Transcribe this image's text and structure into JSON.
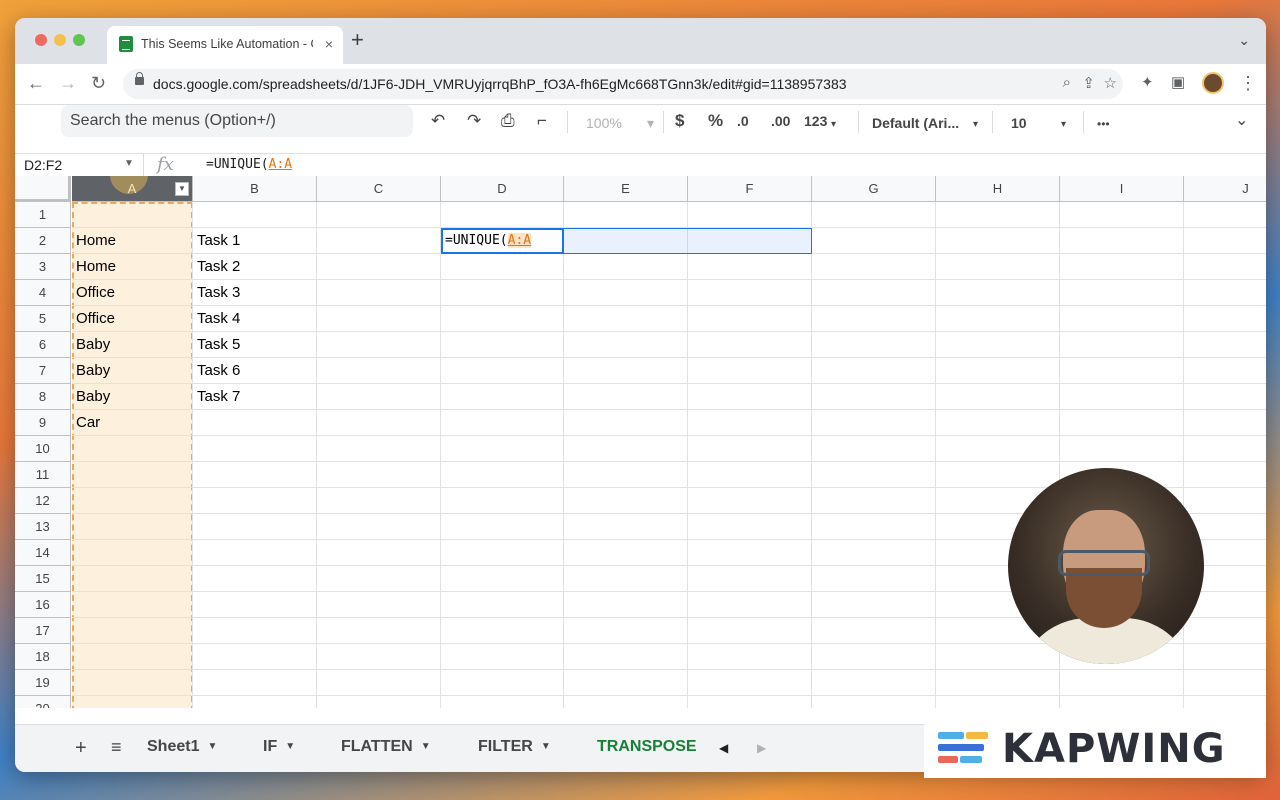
{
  "browser": {
    "tab_title": "This Seems Like Automation - G",
    "tab_close": "×",
    "new_tab": "+",
    "tabs_menu": "⌄",
    "url": "docs.google.com/spreadsheets/d/1JF6-JDH_VMRUyjqrrqBhP_fO3A-fh6EgMc668TGnn3k/edit#gid=1138957383",
    "nav": {
      "back": "←",
      "forward": "→",
      "reload": "↻"
    }
  },
  "toolbar": {
    "search_placeholder": "Search the menus (Option+/)",
    "undo": "↶",
    "redo": "↷",
    "print": "⎙",
    "paint": "⌐",
    "zoom": "100%",
    "currency": "$",
    "percent": "%",
    "decrease_decimal": ".0",
    "increase_decimal": ".00",
    "number_format": "123",
    "font": "Default (Ari...",
    "font_size": "10",
    "more": "•••",
    "collapse": "⌄"
  },
  "formula_bar": {
    "name_box": "D2:F2",
    "fx": "fx",
    "formula_prefix": "=UNIQUE(",
    "formula_ref": "A:A"
  },
  "grid": {
    "columns": [
      "A",
      "B",
      "C",
      "D",
      "E",
      "F",
      "G",
      "H",
      "I",
      "J"
    ],
    "rows": [
      "1",
      "2",
      "3",
      "4",
      "5",
      "6",
      "7",
      "8",
      "9",
      "10",
      "11",
      "12",
      "13",
      "14",
      "15",
      "16",
      "17",
      "18",
      "19",
      "20"
    ],
    "colA": [
      "",
      "Home",
      "Home",
      "Office",
      "Office",
      "Baby",
      "Baby",
      "Baby",
      "Car"
    ],
    "colB": [
      "",
      "Task 1",
      "Task 2",
      "Task 3",
      "Task 4",
      "Task 5",
      "Task 6",
      "Task 7"
    ],
    "active_cell": {
      "prefix": "=UNIQUE(",
      "ref": "A:A"
    }
  },
  "sheets": {
    "add": "+",
    "all_sheets": "≡",
    "tabs": [
      "Sheet1",
      "IF",
      "FLATTEN",
      "FILTER",
      "TRANSPOSE"
    ],
    "active": "TRANSPOSE",
    "scroll_left": "◀",
    "scroll_right": "▶"
  },
  "kapwing": {
    "text": "KAPWING",
    "colors": [
      "#4fb0e8",
      "#f5b942",
      "#3b6fd8",
      "#e8685a"
    ]
  }
}
